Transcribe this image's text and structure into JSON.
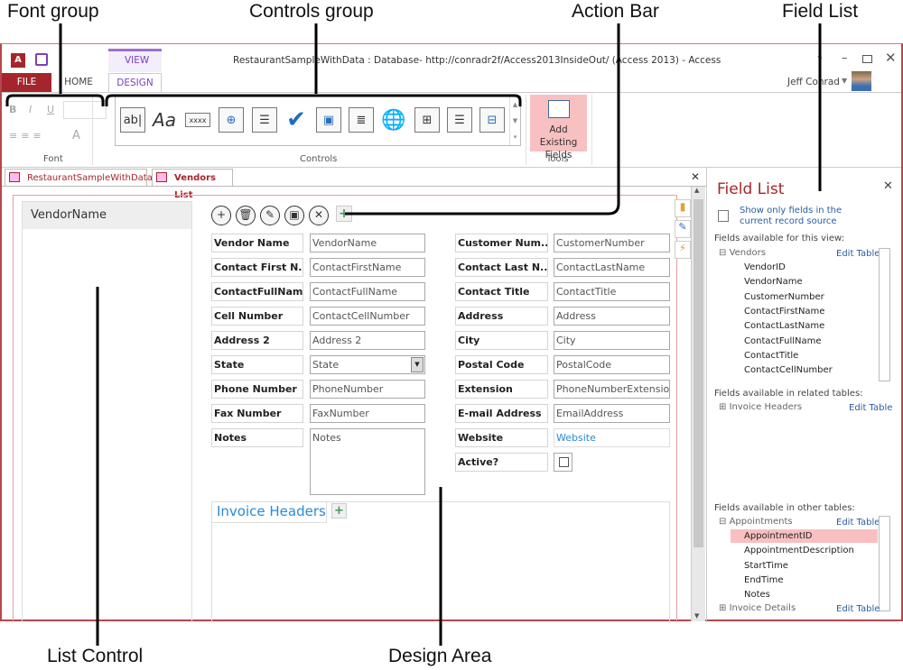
{
  "callouts": {
    "font_group": "Font group",
    "controls_group": "Controls group",
    "action_bar": "Action Bar",
    "field_list": "Field List",
    "list_control": "List Control",
    "design_area": "Design Area"
  },
  "window": {
    "title": "RestaurantSampleWithData : Database- http://conradr2f/Access2013InsideOut/ (Access 2013) - Access",
    "help": "?",
    "user": "Jeff Conrad"
  },
  "ribbon": {
    "context_tab": "VIEW",
    "tabs": [
      "FILE",
      "HOME",
      "DESIGN"
    ],
    "font_buttons": [
      "B",
      "I",
      "U"
    ],
    "font_color": "A",
    "groups": {
      "font": "Font",
      "controls": "Controls",
      "tools": "Tools"
    },
    "controls": [
      "ab|",
      "Aa",
      "xxxx",
      "web-browser-icon",
      "combo-box-icon",
      "checkbox-icon",
      "image-icon",
      "multiline-textbox-icon",
      "hyperlink-icon",
      "related-items-icon",
      "listbox-icon",
      "subview-icon"
    ],
    "add_existing_fields": "Add Existing Fields"
  },
  "doc_tabs": [
    "RestaurantSampleWithData",
    "Vendors List"
  ],
  "list_control": {
    "header": "VendorName"
  },
  "action_bar": [
    "add-icon",
    "delete-icon",
    "edit-icon",
    "save-icon",
    "cancel-icon",
    "add-custom-action-icon"
  ],
  "form": {
    "left": [
      {
        "label": "Vendor Name",
        "value": "VendorName"
      },
      {
        "label": "Contact First N...",
        "value": "ContactFirstName"
      },
      {
        "label": "ContactFullName",
        "value": "ContactFullName"
      },
      {
        "label": "Cell Number",
        "value": "ContactCellNumber"
      },
      {
        "label": "Address 2",
        "value": "Address 2"
      },
      {
        "label": "State",
        "value": "State"
      },
      {
        "label": "Phone Number",
        "value": "PhoneNumber"
      },
      {
        "label": "Fax Number",
        "value": "FaxNumber"
      },
      {
        "label": "Notes",
        "value": "Notes"
      }
    ],
    "right": [
      {
        "label": "Customer Num...",
        "value": "CustomerNumber"
      },
      {
        "label": "Contact Last N...",
        "value": "ContactLastName"
      },
      {
        "label": "Contact Title",
        "value": "ContactTitle"
      },
      {
        "label": "Address",
        "value": "Address"
      },
      {
        "label": "City",
        "value": "City"
      },
      {
        "label": "Postal Code",
        "value": "PostalCode"
      },
      {
        "label": "Extension",
        "value": "PhoneNumberExtension"
      },
      {
        "label": "E-mail Address",
        "value": "EmailAddress"
      },
      {
        "label": "Website",
        "value": "Website"
      },
      {
        "label": "Active?",
        "value": ""
      }
    ],
    "subview": "Invoice Headers"
  },
  "field_list": {
    "title": "Field List",
    "show_only": "Show only fields in the current record source",
    "this_view": "Fields available for this view:",
    "vendors_table": "Vendors",
    "vendors_fields": [
      "VendorID",
      "VendorName",
      "CustomerNumber",
      "ContactFirstName",
      "ContactLastName",
      "ContactFullName",
      "ContactTitle",
      "ContactCellNumber"
    ],
    "related": "Fields available in related tables:",
    "related_table": "Invoice Headers",
    "other": "Fields available in other tables:",
    "appointments_table": "Appointments",
    "appointments_fields": [
      "AppointmentID",
      "AppointmentDescription",
      "StartTime",
      "EndTime",
      "Notes"
    ],
    "invoice_details": "Invoice Details",
    "edit_table": "Edit Table"
  },
  "colors": {
    "accent": "#a4262c",
    "design": "#7a3fbf",
    "selected": "#f8c0c0",
    "link": "#2a5d9f"
  }
}
